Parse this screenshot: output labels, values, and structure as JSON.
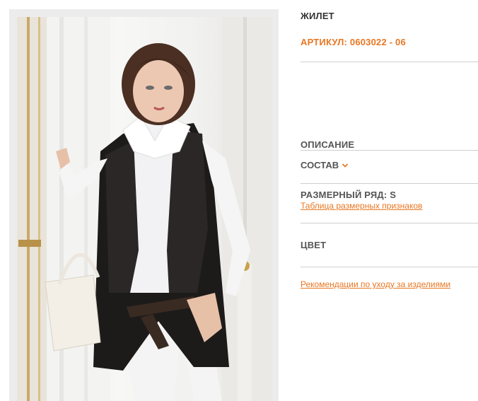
{
  "product": {
    "name": "ЖИЛЕТ",
    "article": "АРТИКУЛ: 0603022 - 06",
    "image_alt": "Модель в черном жилете поверх белой рубашки"
  },
  "sections": {
    "description": "ОПИСАНИЕ",
    "composition": "СОСТАВ",
    "size_range": "РАЗМЕРНЫЙ РЯД: S",
    "size_table_link": "Таблица размерных признаков",
    "color": "ЦВЕТ",
    "care_link": "Рекомендации по уходу за изделиями"
  },
  "icons": {
    "composition_toggle": "chevron-down-icon"
  },
  "colors": {
    "accent": "#e87722",
    "text_dark": "#333333",
    "text_muted": "#555555",
    "divider": "#cfcfcf"
  }
}
